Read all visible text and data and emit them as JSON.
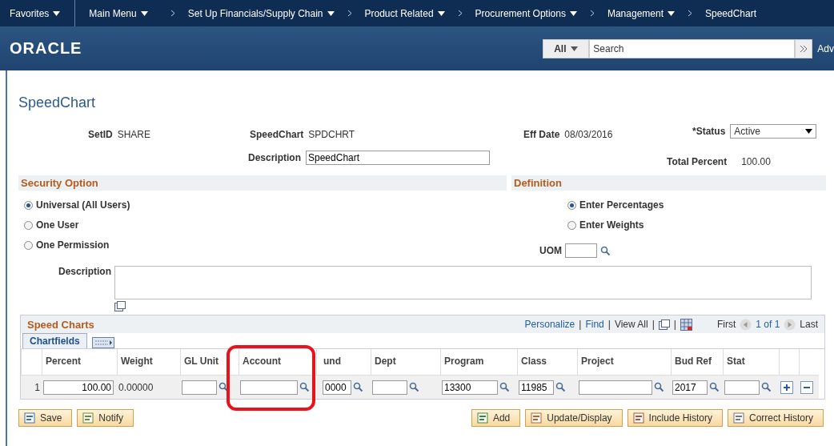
{
  "nav": [
    {
      "label": "Favorites",
      "dropdown": true
    },
    {
      "label": "Main Menu",
      "dropdown": true
    },
    {
      "label": "Set Up Financials/Supply Chain",
      "dropdown": true
    },
    {
      "label": "Product Related",
      "dropdown": true
    },
    {
      "label": "Procurement Options",
      "dropdown": true
    },
    {
      "label": "Management",
      "dropdown": true
    },
    {
      "label": "SpeedChart",
      "dropdown": false
    }
  ],
  "header": {
    "logo": "ORACLE",
    "search_scope": "All",
    "search_placeholder": "Search",
    "advanced": "Adv"
  },
  "page_title": "SpeedChart",
  "fields": {
    "setid_label": "SetID",
    "setid": "SHARE",
    "speedchart_label": "SpeedChart",
    "speedchart": "SPDCHRT",
    "effdate_label": "Eff Date",
    "effdate": "08/03/2016",
    "status_label": "*Status",
    "status": "Active",
    "description_label": "Description",
    "description": "SpeedChart",
    "total_label": "Total Percent",
    "total": "100.00"
  },
  "security_option": {
    "title": "Security Option",
    "options": [
      {
        "label": "Universal (All Users)",
        "selected": true
      },
      {
        "label": "One User",
        "selected": false
      },
      {
        "label": "One Permission",
        "selected": false
      }
    ]
  },
  "definition": {
    "title": "Definition",
    "options": [
      {
        "label": "Enter Percentages",
        "selected": true
      },
      {
        "label": "Enter Weights",
        "selected": false
      }
    ],
    "uom_label": "UOM"
  },
  "long_description_label": "Description",
  "grid": {
    "title": "Speed Charts",
    "tools": [
      {
        "kind": "link",
        "text": "Personalize"
      },
      {
        "kind": "separator",
        "text": "|"
      },
      {
        "kind": "link",
        "text": "Find"
      },
      {
        "kind": "separator",
        "text": "|"
      },
      {
        "kind": "text",
        "text": "View All"
      },
      {
        "kind": "separator",
        "text": "|"
      },
      {
        "kind": "zoom"
      },
      {
        "kind": "separator",
        "text": "|"
      },
      {
        "kind": "download"
      }
    ],
    "first": "First",
    "count": "1 of 1",
    "last": "Last",
    "tab": "Chartfields",
    "columns": [
      "Percent",
      "Weight",
      "GL Unit",
      "Account",
      "und",
      "Dept",
      "Program",
      "Class",
      "Project",
      "Bud Ref",
      "Stat"
    ],
    "rows": [
      {
        "number": "1",
        "cells": [
          {
            "kind": "input",
            "value": "100.00",
            "lookup": false
          },
          {
            "kind": "text",
            "value": "0.00000"
          },
          {
            "kind": "input",
            "lookup": true
          },
          {
            "kind": "input",
            "lookup": true
          },
          {
            "kind": "input",
            "value": "0000",
            "lookup": true
          },
          {
            "kind": "input",
            "lookup": true
          },
          {
            "kind": "input",
            "value": "13300",
            "lookup": true
          },
          {
            "kind": "input",
            "value": "11985",
            "lookup": true
          },
          {
            "kind": "input",
            "lookup": true
          },
          {
            "kind": "input",
            "value": "2017",
            "lookup": true
          },
          {
            "kind": "input",
            "lookup": true
          }
        ]
      }
    ]
  },
  "buttons_left": [
    {
      "label": "Save",
      "kind": "save"
    },
    {
      "label": "Notify",
      "kind": "notify"
    }
  ],
  "buttons_right": [
    {
      "label": "Add",
      "kind": "add"
    },
    {
      "label": "Update/Display",
      "kind": "update"
    },
    {
      "label": "Include History",
      "kind": "include"
    },
    {
      "label": "Correct History",
      "kind": "correct"
    }
  ]
}
